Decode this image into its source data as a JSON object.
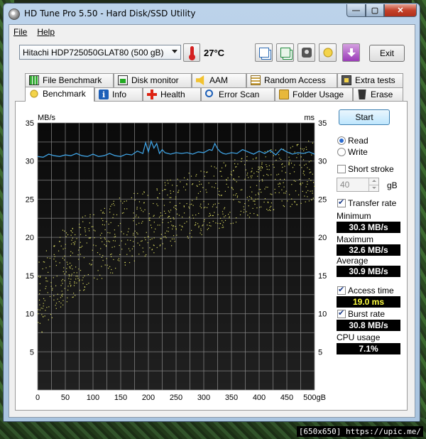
{
  "window": {
    "title": "HD Tune Pro 5.50 - Hard Disk/SSD Utility"
  },
  "menu": {
    "file": "File",
    "help": "Help"
  },
  "toolbar": {
    "drive": "Hitachi HDP725050GLAT80 (500 gB)",
    "temperature": "27°C",
    "exit_label": "Exit",
    "icons": [
      "copy-text-icon",
      "copy-screenshot-icon",
      "camera-icon",
      "coins-icon",
      "download-icon"
    ]
  },
  "tabs_top": [
    {
      "label": "File Benchmark",
      "icon": "file-benchmark-icon"
    },
    {
      "label": "Disk monitor",
      "icon": "disk-monitor-icon"
    },
    {
      "label": "AAM",
      "icon": "speaker-icon"
    },
    {
      "label": "Random Access",
      "icon": "random-access-icon"
    },
    {
      "label": "Extra tests",
      "icon": "extra-tests-icon"
    }
  ],
  "tabs_bottom": [
    {
      "label": "Benchmark",
      "icon": "benchmark-icon"
    },
    {
      "label": "Info",
      "icon": "info-icon"
    },
    {
      "label": "Health",
      "icon": "health-icon"
    },
    {
      "label": "Error Scan",
      "icon": "error-scan-icon"
    },
    {
      "label": "Folder Usage",
      "icon": "folder-icon"
    },
    {
      "label": "Erase",
      "icon": "erase-icon"
    }
  ],
  "controls": {
    "start": "Start",
    "read": "Read",
    "write": "Write",
    "mode_selected": "Read",
    "short_stroke": "Short stroke",
    "short_stroke_checked": false,
    "short_stroke_value": "40",
    "short_stroke_unit": "gB",
    "transfer_rate": "Transfer rate",
    "transfer_rate_checked": true,
    "minimum_label": "Minimum",
    "minimum": "30.3 MB/s",
    "maximum_label": "Maximum",
    "maximum": "32.6 MB/s",
    "average_label": "Average",
    "average": "30.9 MB/s",
    "access_time": "Access time",
    "access_time_checked": true,
    "access_time_value": "19.0 ms",
    "burst_rate": "Burst rate",
    "burst_rate_checked": true,
    "burst_rate_value": "30.8 MB/s",
    "cpu_usage_label": "CPU usage",
    "cpu_usage": "7.1%"
  },
  "watermark": "[650x650] https://upic.me/",
  "colors": {
    "transfer_line": "#3ea0e0",
    "access_points": "#d8d860",
    "grid": "#8a8a8a"
  },
  "chart_data": {
    "type": "line",
    "y_left_label": "MB/s",
    "y_right_label": "ms",
    "x_unit": "gB",
    "x_ticks": [
      "0",
      "50",
      "100",
      "150",
      "200",
      "250",
      "300",
      "350",
      "400",
      "450",
      "500gB"
    ],
    "y_left_ticks": [
      "35",
      "30",
      "25",
      "20",
      "15",
      "10",
      "5"
    ],
    "y_right_ticks": [
      "35",
      "30",
      "25",
      "20",
      "15",
      "10",
      "5"
    ],
    "xlim": [
      0,
      500
    ],
    "ylim": [
      0,
      35
    ],
    "series": [
      {
        "name": "Transfer rate",
        "x": [
          0,
          10,
          20,
          30,
          40,
          50,
          60,
          70,
          80,
          90,
          100,
          110,
          120,
          130,
          140,
          150,
          160,
          170,
          180,
          190,
          195,
          200,
          205,
          210,
          215,
          220,
          225,
          230,
          240,
          250,
          260,
          270,
          280,
          290,
          300,
          310,
          315,
          320,
          325,
          330,
          335,
          340,
          350,
          360,
          370,
          380,
          390,
          400,
          410,
          420,
          430,
          440,
          450,
          460,
          470,
          480,
          490,
          500
        ],
        "y": [
          30.6,
          30.5,
          30.9,
          30.7,
          30.6,
          30.8,
          30.7,
          31.0,
          30.7,
          30.6,
          30.9,
          30.6,
          30.7,
          31.0,
          30.7,
          30.6,
          30.9,
          30.8,
          31.3,
          31.0,
          32.4,
          31.2,
          32.6,
          31.7,
          32.3,
          31.0,
          31.5,
          31.1,
          30.9,
          31.1,
          31.0,
          31.1,
          30.9,
          31.2,
          31.1,
          31.5,
          31.4,
          32.3,
          31.6,
          31.2,
          31.0,
          30.9,
          31.1,
          31.0,
          31.5,
          31.2,
          30.9,
          31.3,
          31.0,
          31.4,
          30.8,
          31.6,
          31.2,
          30.9,
          31.1,
          31.0,
          31.2,
          30.9
        ]
      },
      {
        "name": "Access time",
        "style": "points",
        "x_range": [
          0,
          500
        ],
        "y_trend_from": [
          5,
          16
        ],
        "y_trend_to": [
          25,
          33
        ],
        "count": 900
      }
    ]
  }
}
